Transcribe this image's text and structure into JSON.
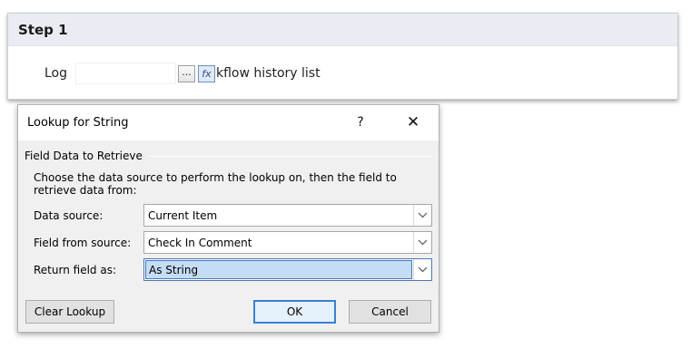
{
  "step": {
    "title": "Step 1",
    "field_label": "Log",
    "input_value": "",
    "ellipsis_label": "...",
    "lookup_icon_glyph": "fx",
    "trailing_text": "kflow history list"
  },
  "dialog": {
    "title": "Lookup for String",
    "help_label": "?",
    "close_label": "✕",
    "section_legend": "Field Data to Retrieve",
    "instructions": "Choose the data source to perform the lookup on, then the field to retrieve data from:",
    "rows": [
      {
        "label": "Data source:",
        "value": "Current Item"
      },
      {
        "label": "Field from source:",
        "value": "Check In Comment"
      },
      {
        "label": "Return field as:",
        "value": "As String"
      }
    ],
    "buttons": {
      "clear_lookup": "Clear Lookup",
      "ok": "OK",
      "cancel": "Cancel"
    }
  },
  "colors": {
    "accent": "#3c7fd1",
    "selection": "#c5dcf5",
    "header_bg": "#e9ecf2"
  }
}
